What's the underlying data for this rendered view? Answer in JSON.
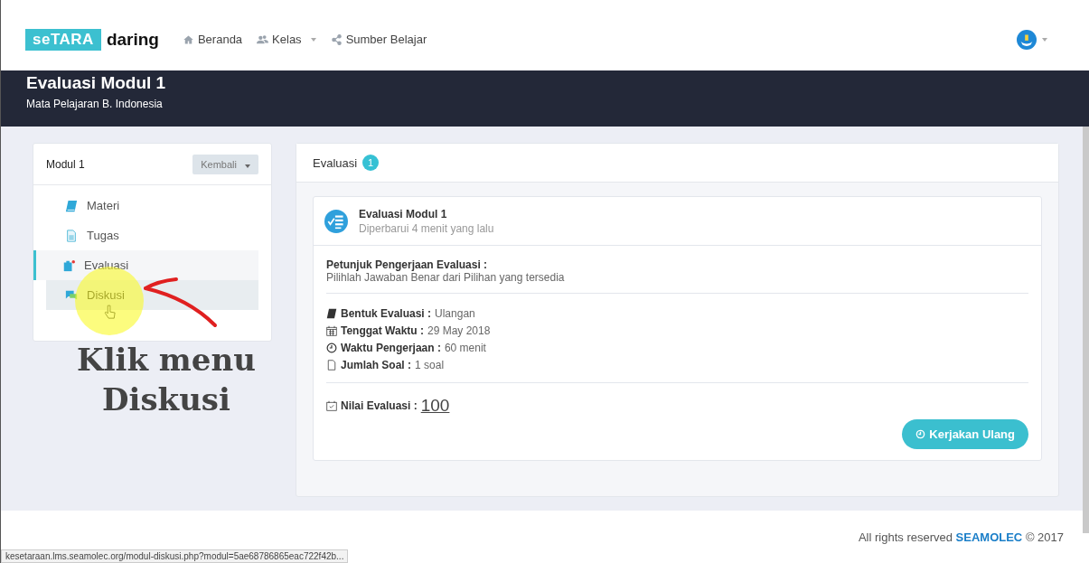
{
  "navbar": {
    "logo_highlight": "seTARA",
    "logo_text": "daring",
    "links": [
      {
        "label": "Beranda",
        "kind": "home",
        "dropdown": false
      },
      {
        "label": "Kelas",
        "kind": "users",
        "dropdown": true
      },
      {
        "label": "Sumber Belajar",
        "kind": "share",
        "dropdown": false
      }
    ]
  },
  "page_header": {
    "title": "Evaluasi Modul 1",
    "subtitle": "Mata Pelajaran B. Indonesia"
  },
  "sidebar": {
    "title": "Modul 1",
    "back_button": "Kembali",
    "items": [
      {
        "label": "Materi",
        "kind": "book",
        "selected": false,
        "hovered": false
      },
      {
        "label": "Tugas",
        "kind": "document",
        "selected": false,
        "hovered": false
      },
      {
        "label": "Evaluasi",
        "kind": "clipboard",
        "selected": true,
        "hovered": false
      },
      {
        "label": "Diskusi",
        "kind": "chat",
        "selected": false,
        "hovered": true
      }
    ]
  },
  "annotation": {
    "caption": "Klik menu Diskusi"
  },
  "panel": {
    "title": "Evaluasi",
    "badge": "1",
    "card": {
      "title": "Evaluasi Modul 1",
      "updated": "Diperbarui 4 menit yang lalu",
      "instructions_label": "Petunjuk Pengerjaan Evaluasi :",
      "instructions": "Pilihlah Jawaban Benar dari Pilihan yang tersedia",
      "details": [
        {
          "kind": "book",
          "label": "Bentuk Evaluasi :",
          "value": "Ulangan"
        },
        {
          "kind": "calendar",
          "label": "Tenggat Waktu :",
          "value": "29 May 2018"
        },
        {
          "kind": "clock",
          "label": "Waktu Pengerjaan :",
          "value": "60 menit"
        },
        {
          "kind": "file",
          "label": "Jumlah Soal :",
          "value": "1 soal"
        }
      ],
      "score_label": "Nilai Evaluasi :",
      "score": "100",
      "retry_button": "Kerjakan Ulang"
    }
  },
  "footer": {
    "text": "All rights reserved",
    "brand": "SEAMOLEC",
    "copyright": "© 2017"
  },
  "status_bar": {
    "url": "kesetaraan.lms.seamolec.org/modul-diskusi.php?modul=5ae68786865eac722f42b..."
  }
}
